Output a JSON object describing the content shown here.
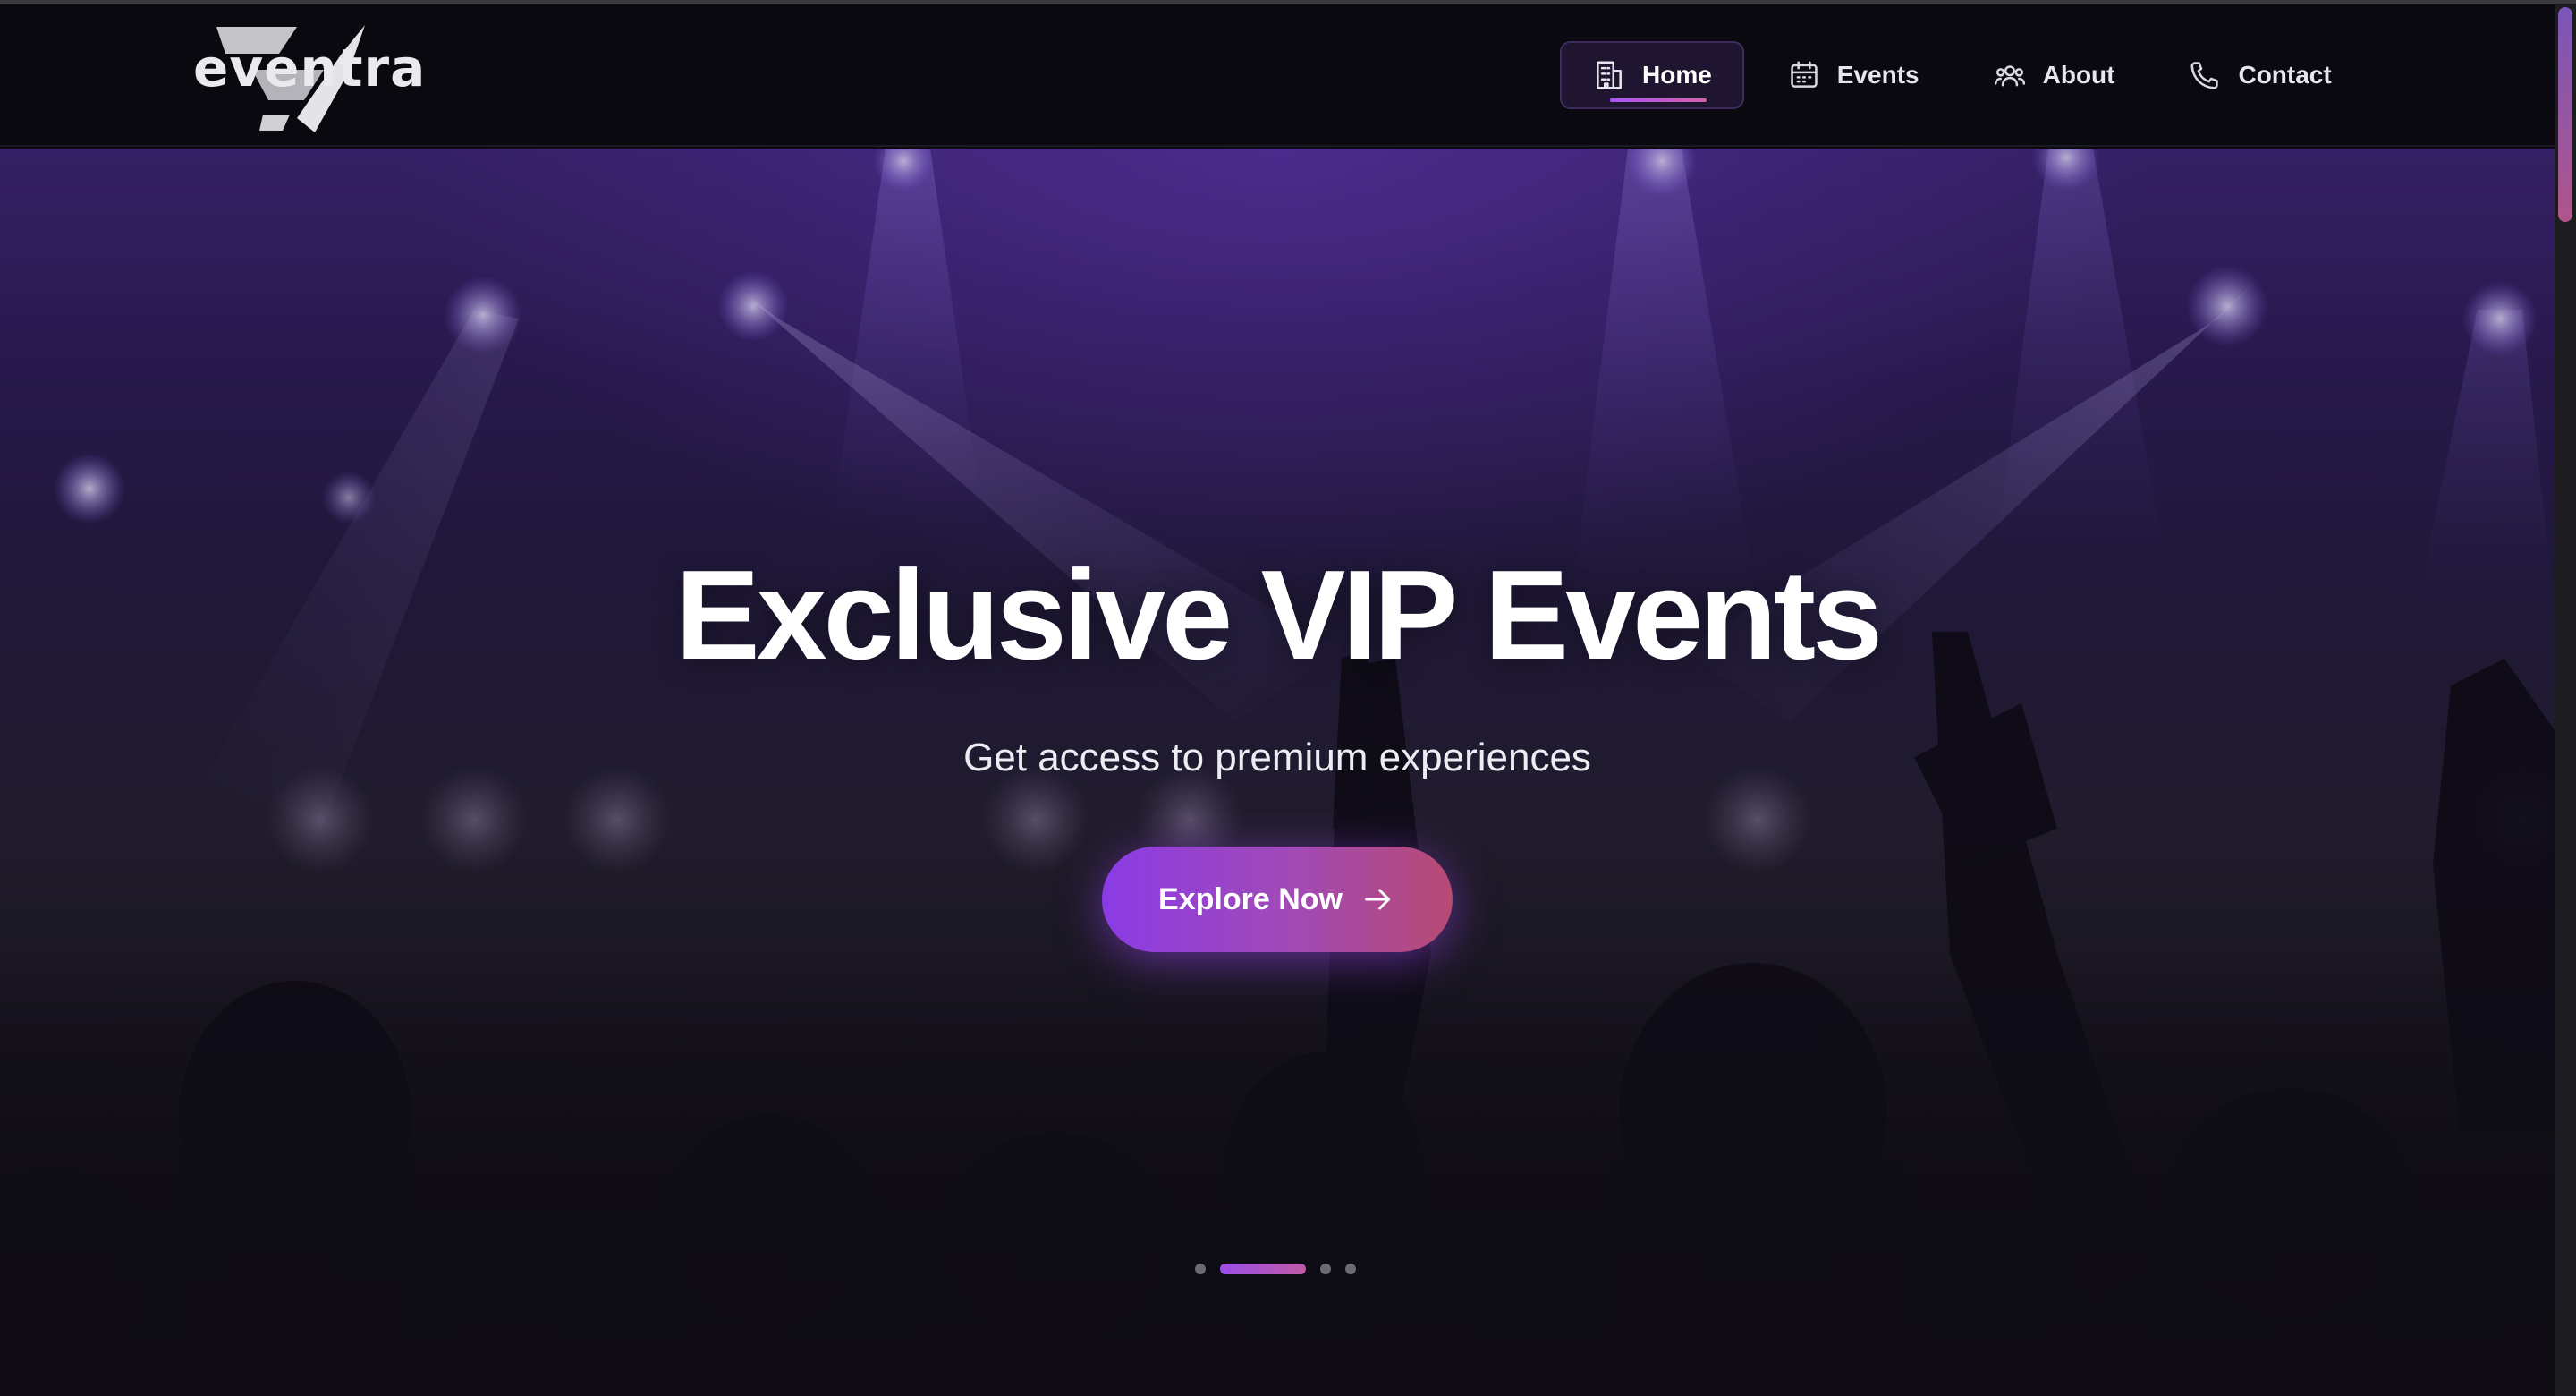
{
  "brand": {
    "logo_text": "eventra",
    "logo_icon": "eventra-logo-mark"
  },
  "nav": {
    "items": [
      {
        "label": "Home",
        "icon": "building-icon",
        "active": true
      },
      {
        "label": "Events",
        "icon": "calendar-icon",
        "active": false
      },
      {
        "label": "About",
        "icon": "users-icon",
        "active": false
      },
      {
        "label": "Contact",
        "icon": "phone-icon",
        "active": false
      }
    ]
  },
  "hero": {
    "title": "Exclusive VIP Events",
    "subtitle": "Get access to premium experiences",
    "cta_label": "Explore Now",
    "cta_icon": "arrow-right-icon",
    "slides_total": 4,
    "active_slide": 2
  },
  "colors": {
    "accent_purple": "#8b3be6",
    "accent_pink": "#b84a72",
    "header_bg": "#0a090f"
  }
}
